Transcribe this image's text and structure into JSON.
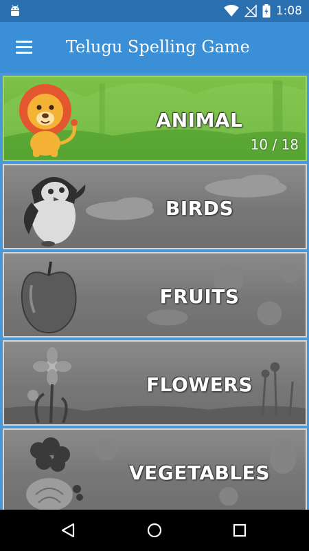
{
  "status_bar": {
    "time": "1:08",
    "icons": [
      "android-icon",
      "wifi-icon",
      "no-signal-icon",
      "battery-charging-icon"
    ]
  },
  "app_bar": {
    "title": "Telugu Spelling Game",
    "menu_icon": "hamburger-menu-icon"
  },
  "categories": [
    {
      "label": "ANIMAL",
      "progress": "10 / 18",
      "state": "unlocked",
      "icon": "lion-icon"
    },
    {
      "label": "BIRDS",
      "state": "locked",
      "icon": "penguin-icon"
    },
    {
      "label": "FRUITS",
      "state": "locked",
      "icon": "apple-icon"
    },
    {
      "label": "FLOWERS",
      "state": "locked",
      "icon": "flower-icon"
    },
    {
      "label": "VEGETABLES",
      "state": "locked",
      "icon": "vegetables-icon"
    }
  ],
  "nav_bar": {
    "buttons": [
      "back-icon",
      "home-icon",
      "recents-icon"
    ]
  },
  "colors": {
    "status_bar": "#2a6fb0",
    "app_bar": "#3a8fd6",
    "active_card": "#6cb43c",
    "locked_card": "#777777"
  }
}
